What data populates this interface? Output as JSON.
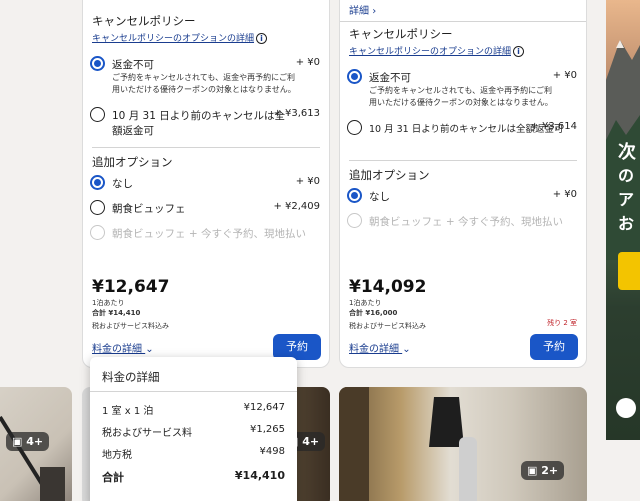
{
  "card1": {
    "cancel_title": "キャンセルポリシー",
    "cancel_link": "キャンセルポリシーのオプションの詳細",
    "opt1_label": "返金不可",
    "opt1_price": "+ ¥0",
    "opt1_desc1": "ご予約をキャンセルされても、返金や再予約にご利",
    "opt1_desc2": "用いただける優待クーポンの対象とはなりません。",
    "opt2_label1": "10 月 31 日より前のキャンセルは全",
    "opt2_label2": "額返金可",
    "opt2_price": "+ ¥3,613",
    "extra_title": "追加オプション",
    "ex1_label": "なし",
    "ex1_price": "+ ¥0",
    "ex2_label": "朝食ビュッフェ",
    "ex2_price": "+ ¥2,409",
    "ex3_label": "朝食ビュッフェ + 今すぐ予約、現地払い",
    "price": "¥12,647",
    "per_night": "1泊あたり",
    "total": "合計 ¥14,410",
    "tax_note": "税およびサービス料込み",
    "details_link": "料金の詳細",
    "book": "予約"
  },
  "card2": {
    "top_link": "詳細",
    "cancel_title": "キャンセルポリシー",
    "cancel_link": "キャンセルポリシーのオプションの詳細",
    "opt1_label": "返金不可",
    "opt1_price": "+ ¥0",
    "opt1_desc1": "ご予約をキャンセルされても、返金や再予約にご利",
    "opt1_desc2": "用いただける優待クーポンの対象とはなりません。",
    "opt2_label": "10 月 31 日より前のキャンセルは全額返金可",
    "opt2_price": "+ ¥3,614",
    "extra_title": "追加オプション",
    "ex1_label": "なし",
    "ex1_price": "+ ¥0",
    "ex2_label": "朝食ビュッフェ + 今すぐ予約、現地払い",
    "price": "¥14,092",
    "per_night": "1泊あたり",
    "total": "合計 ¥16,000",
    "tax_note": "税およびサービス料込み",
    "remaining": "残り 2 室",
    "details_link": "料金の詳細",
    "book": "予約"
  },
  "popover": {
    "title": "料金の詳細",
    "row1_label": "1 室 x 1 泊",
    "row1_value": "¥12,647",
    "row2_label": "税およびサービス料",
    "row2_value": "¥1,265",
    "row3_label": "地方税",
    "row3_value": "¥498",
    "total_label": "合計",
    "total_value": "¥14,410"
  },
  "photos": {
    "badge1": "4+",
    "badge2": "4+",
    "badge3": "2+"
  },
  "ad": {
    "t1": "次",
    "t2": "の",
    "t3": "ア",
    "t4": "お"
  },
  "colors": {
    "accent": "#1a56c7",
    "warning": "#c0262d"
  }
}
